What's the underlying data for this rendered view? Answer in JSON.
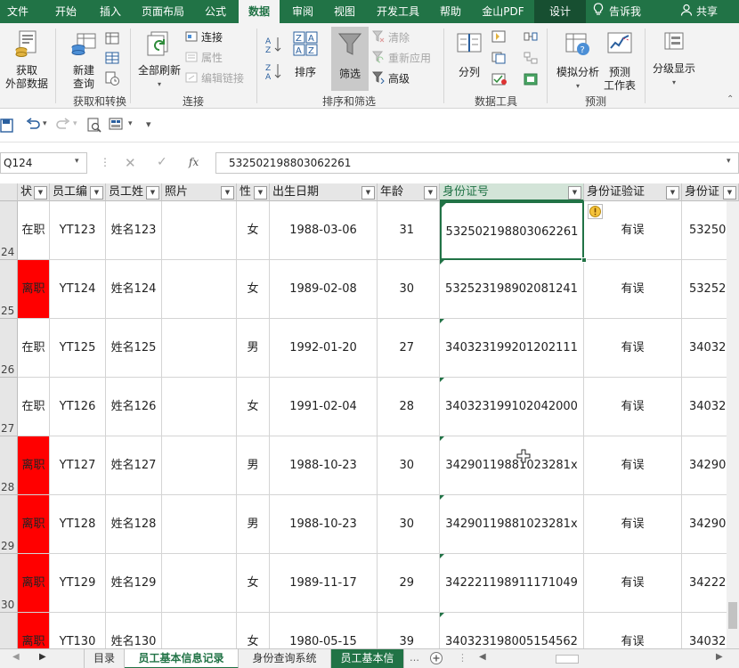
{
  "tabs": [
    {
      "label": "文件",
      "state": "normal"
    },
    {
      "label": "开始",
      "state": "normal"
    },
    {
      "label": "插入",
      "state": "normal"
    },
    {
      "label": "页面布局",
      "state": "normal"
    },
    {
      "label": "公式",
      "state": "normal"
    },
    {
      "label": "数据",
      "state": "active"
    },
    {
      "label": "审阅",
      "state": "normal"
    },
    {
      "label": "视图",
      "state": "normal"
    },
    {
      "label": "开发工具",
      "state": "normal"
    },
    {
      "label": "帮助",
      "state": "normal"
    },
    {
      "label": "金山PDF",
      "state": "normal"
    },
    {
      "label": "设计",
      "state": "design"
    }
  ],
  "tellme": "告诉我",
  "share": "共享",
  "ribbon": {
    "get_external": "获取\n外部数据",
    "new_query": "新建\n查询",
    "group_get": "获取和转换",
    "refresh_all": "全部刷新",
    "connections": "连接",
    "properties": "属性",
    "edit_links": "编辑链接",
    "group_conn": "连接",
    "sort": "排序",
    "filter": "筛选",
    "clear": "清除",
    "reapply": "重新应用",
    "advanced": "高级",
    "group_sort": "排序和筛选",
    "split": "分列",
    "group_tools": "数据工具",
    "whatif": "模拟分析",
    "forecast": "预测\n工作表",
    "group_forecast": "预测",
    "outline": "分级显示"
  },
  "namebox": "Q124",
  "formula": "532502198803062261",
  "fx": "fx",
  "columns": [
    "状",
    "员工编",
    "员工姓",
    "照片",
    "性",
    "出生日期",
    "年龄",
    "身份证号",
    "身份证验证",
    "身份证"
  ],
  "rows": [
    {
      "num": "24",
      "status": "在职",
      "status_red": false,
      "id": "YT123",
      "name": "姓名123",
      "gender": "女",
      "dob": "1988-03-06",
      "age": "31",
      "idno": "532502198803062261",
      "verify": "有误",
      "idno2": "53250"
    },
    {
      "num": "25",
      "status": "离职",
      "status_red": true,
      "id": "YT124",
      "name": "姓名124",
      "gender": "女",
      "dob": "1989-02-08",
      "age": "30",
      "idno": "532523198902081241",
      "verify": "有误",
      "idno2": "53252"
    },
    {
      "num": "26",
      "status": "在职",
      "status_red": false,
      "id": "YT125",
      "name": "姓名125",
      "gender": "男",
      "dob": "1992-01-20",
      "age": "27",
      "idno": "340323199201202111",
      "verify": "有误",
      "idno2": "34032"
    },
    {
      "num": "27",
      "status": "在职",
      "status_red": false,
      "id": "YT126",
      "name": "姓名126",
      "gender": "女",
      "dob": "1991-02-04",
      "age": "28",
      "idno": "340323199102042000",
      "verify": "有误",
      "idno2": "34032"
    },
    {
      "num": "28",
      "status": "离职",
      "status_red": true,
      "id": "YT127",
      "name": "姓名127",
      "gender": "男",
      "dob": "1988-10-23",
      "age": "30",
      "idno": "34290119881023281x",
      "verify": "有误",
      "idno2": "34290"
    },
    {
      "num": "29",
      "status": "离职",
      "status_red": true,
      "id": "YT128",
      "name": "姓名128",
      "gender": "男",
      "dob": "1988-10-23",
      "age": "30",
      "idno": "34290119881023281x",
      "verify": "有误",
      "idno2": "34290"
    },
    {
      "num": "30",
      "status": "离职",
      "status_red": true,
      "id": "YT129",
      "name": "姓名129",
      "gender": "女",
      "dob": "1989-11-17",
      "age": "29",
      "idno": "342221198911171049",
      "verify": "有误",
      "idno2": "34222"
    },
    {
      "num": "31",
      "status": "离职",
      "status_red": true,
      "id": "YT130",
      "name": "姓名130",
      "gender": "女",
      "dob": "1980-05-15",
      "age": "39",
      "idno": "340323198005154562",
      "verify": "有误",
      "idno2": "34032"
    }
  ],
  "sheets": [
    {
      "label": "目录",
      "state": "normal"
    },
    {
      "label": "员工基本信息记录",
      "state": "active"
    },
    {
      "label": "身份查询系统",
      "state": "normal"
    },
    {
      "label": "员工基本信",
      "state": "next"
    }
  ],
  "colors": {
    "accent": "#217346",
    "red": "#ff0000"
  }
}
